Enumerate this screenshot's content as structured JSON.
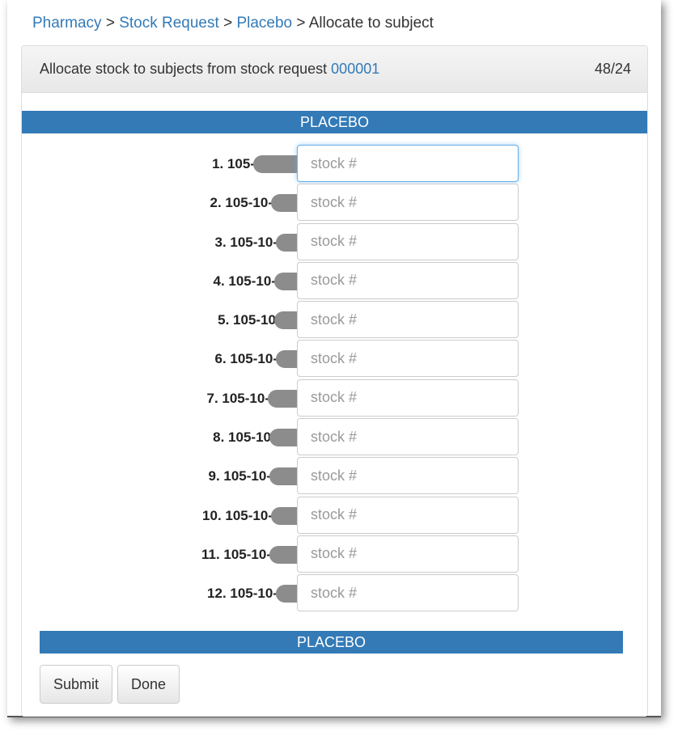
{
  "breadcrumb": {
    "items": [
      "Pharmacy",
      "Stock Request",
      "Placebo"
    ],
    "separator": ">",
    "current": "Allocate to subject"
  },
  "panel": {
    "heading_text": "Allocate stock to subjects from stock request",
    "request_id": "000001",
    "count": "48/24"
  },
  "group_label": "PLACEBO",
  "rows": [
    {
      "label": "1. 105-"
    },
    {
      "label": "2. 105-10-"
    },
    {
      "label": "3. 105-10-"
    },
    {
      "label": "4. 105-10-"
    },
    {
      "label": "5. 105-10"
    },
    {
      "label": "6. 105-10-"
    },
    {
      "label": "7. 105-10-"
    },
    {
      "label": "8. 105-10"
    },
    {
      "label": "9. 105-10-"
    },
    {
      "label": "10. 105-10-"
    },
    {
      "label": "11. 105-10-"
    },
    {
      "label": "12. 105-10-"
    }
  ],
  "input_placeholder": "stock #",
  "buttons": {
    "submit": "Submit",
    "done": "Done"
  },
  "colors": {
    "accent": "#337ab7",
    "redaction": "#8c8c8c"
  }
}
